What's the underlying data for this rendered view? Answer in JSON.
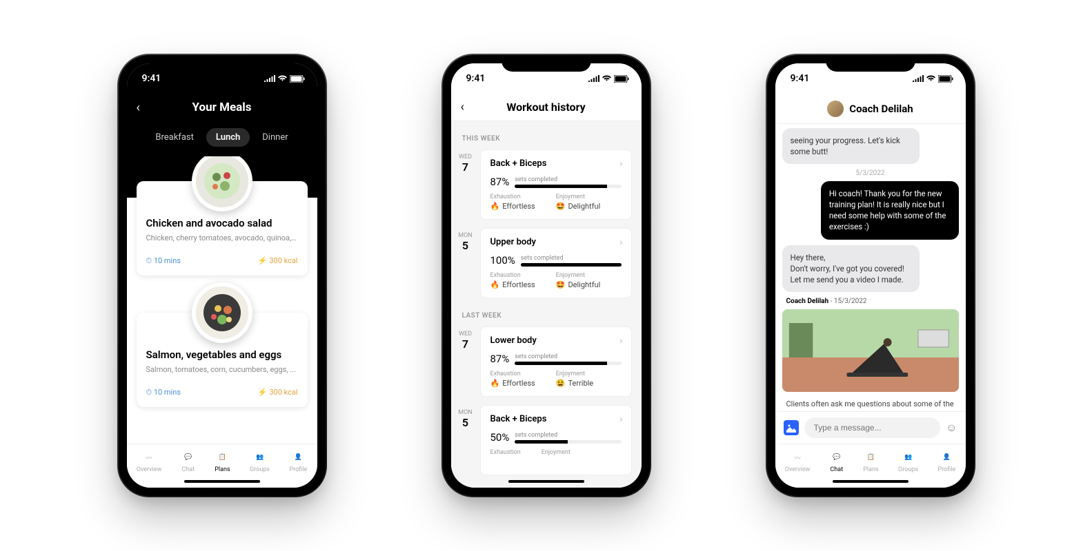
{
  "status_time": "9:41",
  "phone1": {
    "title": "Your Meals",
    "tabs": [
      "Breakfast",
      "Lunch",
      "Dinner"
    ],
    "active_tab": "Lunch",
    "meals": [
      {
        "name": "Chicken and avocado salad",
        "ingredients": "Chicken, cherry tomatoes, avocado, quinoa, ...",
        "time": "10 mins",
        "cal": "300 kcal"
      },
      {
        "name": "Salmon, vegetables and eggs",
        "ingredients": "Salmon, tomatoes, corn, cucumbers, eggs, ...",
        "time": "10 mins",
        "cal": "300 kcal"
      }
    ]
  },
  "phone2": {
    "title": "Workout history",
    "sections": [
      {
        "label": "THIS WEEK",
        "items": [
          {
            "dow": "WED",
            "day": "7",
            "name": "Back + Biceps",
            "pct": "87%",
            "pct_n": 87,
            "prog_label": "sets completed",
            "exh": "Effortless",
            "exh_emo": "🔥",
            "enj": "Delightful",
            "enj_emo": "🤩",
            "exh_label": "Exhaustion",
            "enj_label": "Enjoyment"
          },
          {
            "dow": "MON",
            "day": "5",
            "name": "Upper body",
            "pct": "100%",
            "pct_n": 100,
            "prog_label": "sets completed",
            "exh": "Effortless",
            "exh_emo": "🔥",
            "enj": "Delightful",
            "enj_emo": "🤩",
            "exh_label": "Exhaustion",
            "enj_label": "Enjoyment"
          }
        ]
      },
      {
        "label": "LAST WEEK",
        "items": [
          {
            "dow": "WED",
            "day": "7",
            "name": "Lower body",
            "pct": "87%",
            "pct_n": 87,
            "prog_label": "sets completed",
            "exh": "Effortless",
            "exh_emo": "🔥",
            "enj": "Terrible",
            "enj_emo": "😫",
            "exh_label": "Exhaustion",
            "enj_label": "Enjoyment"
          },
          {
            "dow": "MON",
            "day": "5",
            "name": "Back + Biceps",
            "pct": "50%",
            "pct_n": 50,
            "prog_label": "sets completed",
            "exh": "",
            "exh_emo": "",
            "enj": "",
            "enj_emo": "",
            "exh_label": "Exhaustion",
            "enj_label": "Enjoyment"
          }
        ]
      }
    ]
  },
  "phone3": {
    "title": "Coach Delilah",
    "msg_top": "seeing your progress. Let's kick some butt!",
    "date1": "5/3/2022",
    "msg_out": "Hi coach! Thank you for the new training plan! It is really nice but I need some help with some of the exercises :)",
    "msg_in": "Hey there,\nDon't worry, I've got you covered! Let me send you a video I made.",
    "video_by": "Coach Delilah",
    "video_date": "15/3/2022",
    "video_cap": "Clients often ask me questions about some of the exercises in their training plan. Let me explain to you what you should do.",
    "input_placeholder": "Type a message..."
  },
  "nav": {
    "items": [
      "Overview",
      "Chat",
      "Plans",
      "Groups",
      "Profile"
    ]
  }
}
